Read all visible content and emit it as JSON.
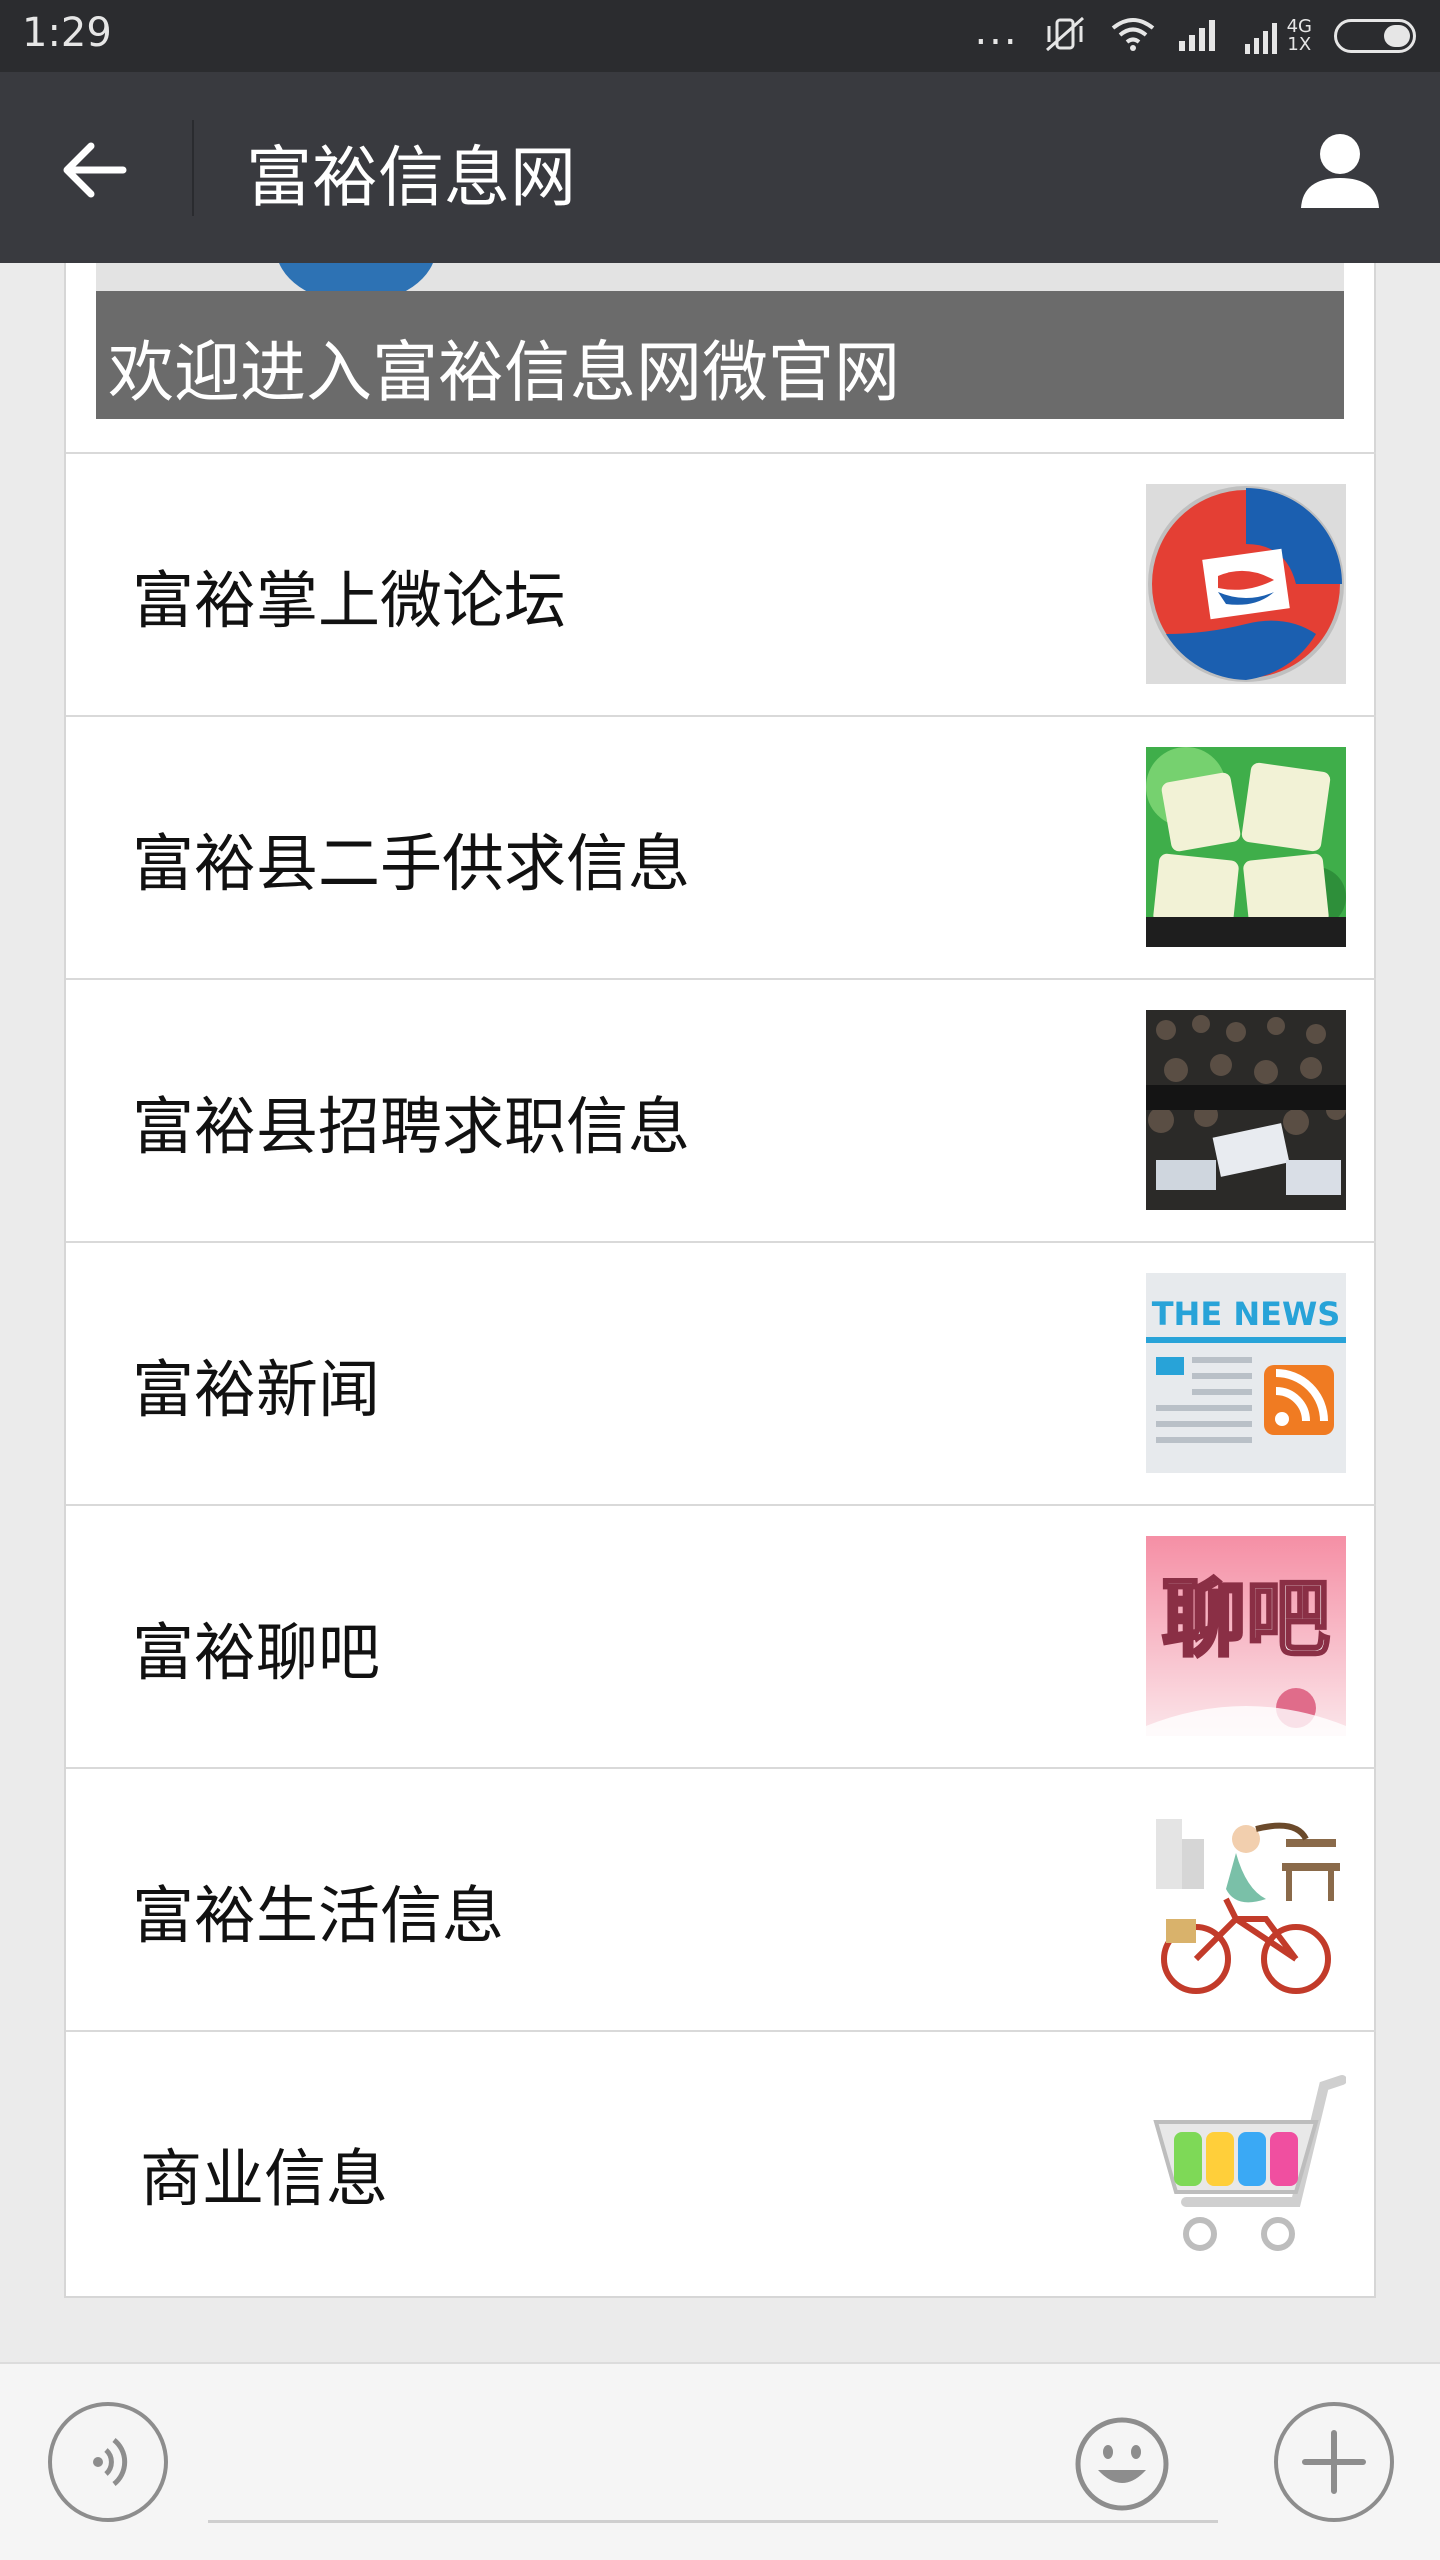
{
  "status_bar": {
    "time": "1:29",
    "network_top": "4G",
    "network_bottom": "1X"
  },
  "header": {
    "title": "富裕信息网"
  },
  "banner": {
    "caption": "欢迎进入富裕信息网微官网"
  },
  "menu": {
    "items": [
      {
        "label": "富裕掌上微论坛",
        "icon": "forum-logo-icon"
      },
      {
        "label": "富裕县二手供求信息",
        "icon": "flea-market-icon"
      },
      {
        "label": "富裕县招聘求职信息",
        "icon": "job-fair-crowd-image"
      },
      {
        "label": "富裕新闻",
        "icon": "news-rss-icon",
        "icon_text": "THE NEWS"
      },
      {
        "label": "富裕聊吧",
        "icon": "chat-bar-icon",
        "icon_text": "聊吧"
      },
      {
        "label": "富裕生活信息",
        "icon": "girl-bicycle-icon"
      },
      {
        "label": "商业信息",
        "icon": "shopping-cart-icon"
      }
    ]
  },
  "colors": {
    "status_bar": "#2b2c2f",
    "title_bar": "#393a3f",
    "page_bg": "#ebebeb",
    "banner_caption_bg": "#6b6b6b"
  }
}
